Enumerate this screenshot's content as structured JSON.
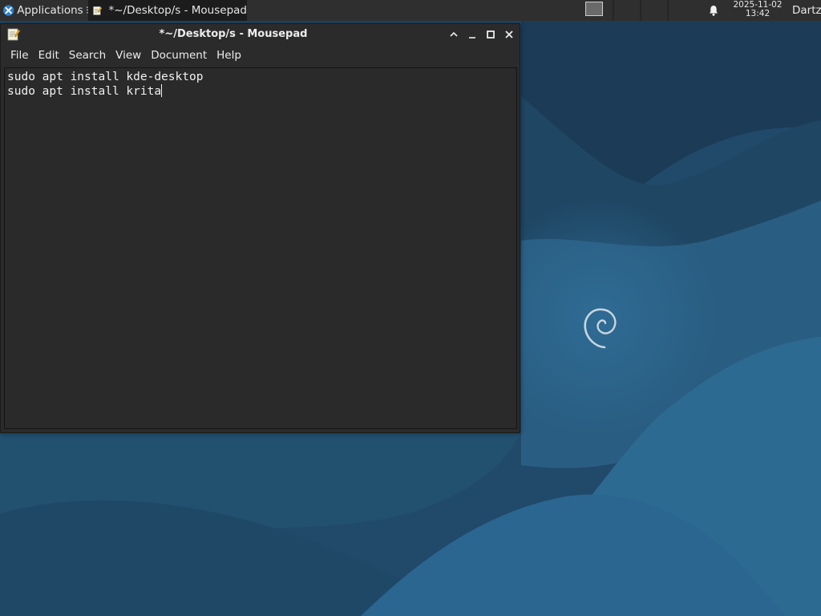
{
  "panel": {
    "applications_label": "Applications",
    "task_button_title": "*~/Desktop/s - Mousepad",
    "clock_date": "2025-11-02",
    "clock_time": "13:42",
    "user_label": "Dartz",
    "icons": {
      "app_menu": "xfce-logo-icon",
      "task": "text-editor-icon",
      "workspace": "workspace-icon",
      "notifications": "bell-icon"
    }
  },
  "window": {
    "title": "*~/Desktop/s - Mousepad",
    "icons": {
      "app": "text-editor-icon",
      "shade": "chevron-up-icon",
      "minimize": "minimize-icon",
      "maximize": "maximize-icon",
      "close": "close-icon"
    },
    "menu": [
      "File",
      "Edit",
      "Search",
      "View",
      "Document",
      "Help"
    ],
    "editor_lines": [
      "sudo apt install kde-desktop",
      "sudo apt install krita"
    ]
  },
  "colors": {
    "panel_bg": "#2f2f2f",
    "window_bg": "#2b2b2b",
    "editor_bg": "#2a2a2a",
    "text": "#ececec",
    "desktop_dark": "#1d3f59",
    "desktop_light": "#2d6a92"
  },
  "desktop": {
    "wallpaper_logo": "debian-swirl-icon"
  }
}
